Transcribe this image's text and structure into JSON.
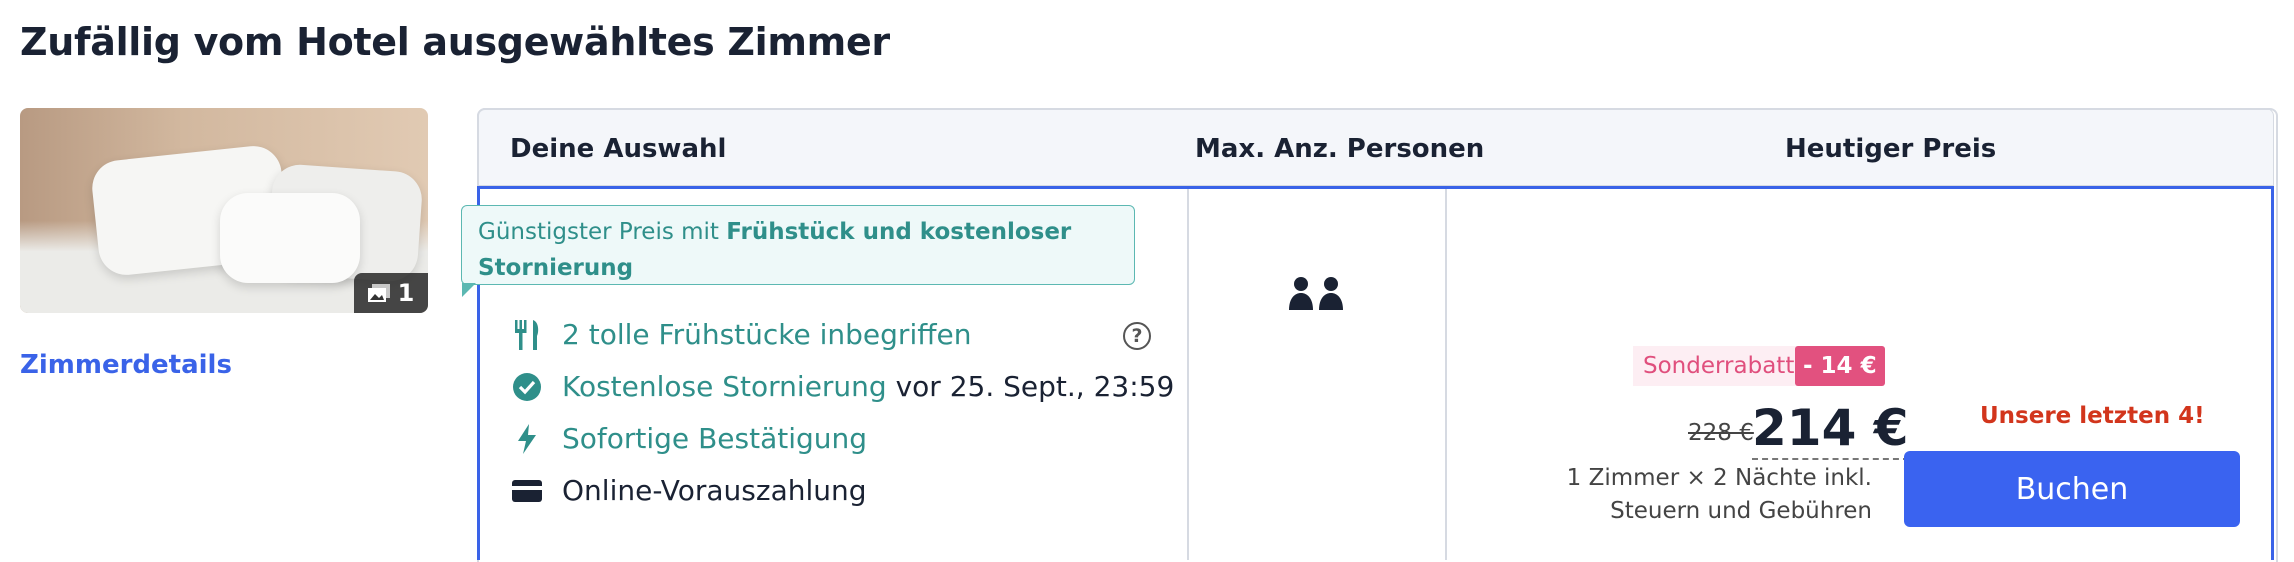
{
  "section_title": "Zufällig vom Hotel ausgewähltes Zimmer",
  "room": {
    "photo_count": "1",
    "details_link": "Zimmerdetails"
  },
  "table": {
    "headers": [
      "Deine Auswahl",
      "Max. Anz. Personen",
      "Heutiger Preis"
    ],
    "tooltip": {
      "prefix": "Günstigster Preis mit ",
      "bold": "Frühstück und kostenloser Stornierung"
    },
    "features": [
      {
        "icon": "cutlery-icon",
        "text": "2 tolle Frühstücke inbegriffen",
        "suffix": ""
      },
      {
        "icon": "check-circle-icon",
        "text": "Kostenlose Stornierung",
        "suffix": " vor 25. Sept., 23:59"
      },
      {
        "icon": "lightning-icon",
        "text": "Sofortige Bestätigung",
        "suffix": ""
      },
      {
        "icon": "credit-card-icon",
        "text": "Online-Vorauszahlung",
        "suffix": ""
      }
    ],
    "persons_icon": "two-persons-icon",
    "price": {
      "promo_label": "Sonderrabatt",
      "promo_badge": "- 14 €",
      "old_price": "228 €",
      "new_price": "214 €",
      "note": "1 Zimmer × 2 Nächte inkl. Steuern und Gebühren"
    },
    "scarcity": "Unsere letzten 4!",
    "book_label": "Buchen"
  },
  "colors": {
    "accent": "#3a63f0",
    "teal": "#2f8f8a",
    "promo": "#e2517f",
    "scarcity": "#d2351c"
  }
}
